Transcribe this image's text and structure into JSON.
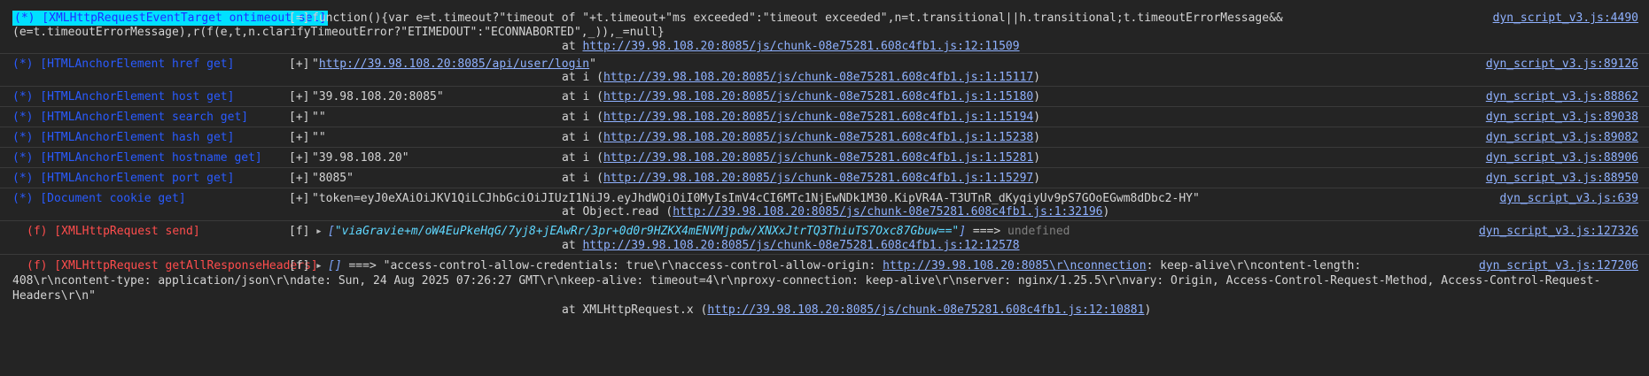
{
  "rows": [
    {
      "tag": "(*) [XMLHttpRequestEventTarget ontimeout set]",
      "prefix": "[=]",
      "code_line1": "function(){var e=t.timeout?\"timeout of \"+t.timeout+\"ms exceeded\":\"timeout exceeded\",n=t.transitional||h.transitional;t.timeoutErrorMessage&&",
      "code_line2": "(e=t.timeoutErrorMessage),r(f(e,t,n.clarifyTimeoutError?\"ETIMEDOUT\":\"ECONNABORTED\",_)),_=null}",
      "at_prefix": "at ",
      "at_link": "http://39.98.108.20:8085/js/chunk-08e75281.608c4fb1.js:12:11509",
      "at_suffix": "",
      "source": "dyn_script_v3.js:4490"
    },
    {
      "tag": "(*) [HTMLAnchorElement href get]",
      "prefix": "[+]",
      "value_open": "\"",
      "value_link": "http://39.98.108.20:8085/api/user/login",
      "value_close": "\"",
      "at_prefix": "at i (",
      "at_link": "http://39.98.108.20:8085/js/chunk-08e75281.608c4fb1.js:1:15117",
      "at_suffix": ")",
      "source": "dyn_script_v3.js:89126"
    },
    {
      "tag": "(*) [HTMLAnchorElement host get]",
      "prefix": "[+]",
      "value": "\"39.98.108.20:8085\"",
      "at_prefix": "at i (",
      "at_link": "http://39.98.108.20:8085/js/chunk-08e75281.608c4fb1.js:1:15180",
      "at_suffix": ")",
      "source": "dyn_script_v3.js:88862"
    },
    {
      "tag": "(*) [HTMLAnchorElement search get]",
      "prefix": "[+]",
      "value": "\"\"",
      "at_prefix": "at i (",
      "at_link": "http://39.98.108.20:8085/js/chunk-08e75281.608c4fb1.js:1:15194",
      "at_suffix": ")",
      "source": "dyn_script_v3.js:89038"
    },
    {
      "tag": "(*) [HTMLAnchorElement hash get]",
      "prefix": "[+]",
      "value": "\"\"",
      "at_prefix": "at i (",
      "at_link": "http://39.98.108.20:8085/js/chunk-08e75281.608c4fb1.js:1:15238",
      "at_suffix": ")",
      "source": "dyn_script_v3.js:89082"
    },
    {
      "tag": "(*) [HTMLAnchorElement hostname get]",
      "prefix": "[+]",
      "value": "\"39.98.108.20\"",
      "at_prefix": "at i (",
      "at_link": "http://39.98.108.20:8085/js/chunk-08e75281.608c4fb1.js:1:15281",
      "at_suffix": ")",
      "source": "dyn_script_v3.js:88906"
    },
    {
      "tag": "(*) [HTMLAnchorElement port get]",
      "prefix": "[+]",
      "value": "\"8085\"",
      "at_prefix": "at i (",
      "at_link": "http://39.98.108.20:8085/js/chunk-08e75281.608c4fb1.js:1:15297",
      "at_suffix": ")",
      "source": "dyn_script_v3.js:88950"
    },
    {
      "tag": "(*) [Document cookie get]",
      "prefix": "[+]",
      "value": "\"token=eyJ0eXAiOiJKV1QiLCJhbGciOiJIUzI1NiJ9.eyJhdWQiOiI0MyIsImV4cCI6MTc1NjEwNDk1M30.KipVR4A-T3UTnR_dKyqiyUv9pS7GOoEGwm8dDbc2-HY\"",
      "at_prefix": "at Object.read (",
      "at_link": "http://39.98.108.20:8085/js/chunk-08e75281.608c4fb1.js:1:32196",
      "at_suffix": ")",
      "source": "dyn_script_v3.js:639"
    },
    {
      "tag": "(f) [XMLHttpRequest send]",
      "prefix": "[f]",
      "triangle": "▸",
      "arg_open": "[",
      "arg_str": "\"viaGravie+m/oW4EuPkeHqG/7yj8+jEAwRr/3pr+0d0r9HZKX4mENVMjpdw/XNXxJtrTQ3ThiuTS7Oxc87Gbuw==\"",
      "arg_close": "]",
      "arrow": " ===> ",
      "result": "undefined",
      "at_prefix": "at ",
      "at_link": "http://39.98.108.20:8085/js/chunk-08e75281.608c4fb1.js:12:12578",
      "at_suffix": "",
      "source": "dyn_script_v3.js:127326"
    },
    {
      "tag": "(f) [XMLHttpRequest getAllResponseHeaders]",
      "prefix": "[f]",
      "triangle": "▸",
      "args": "[]",
      "arrow": " ===> ",
      "hdr_part1": "\"access-control-allow-credentials: true\\r\\naccess-control-allow-origin: ",
      "hdr_link": "http://39.98.108.20:8085\\r\\nconnection",
      "hdr_part2": ": keep-alive\\r\\ncontent-length:",
      "hdr_line2": "408\\r\\ncontent-type: application/json\\r\\ndate: Sun, 24 Aug 2025 07:26:27 GMT\\r\\nkeep-alive: timeout=4\\r\\nproxy-connection: keep-alive\\r\\nserver: nginx/1.25.5\\r\\nvary: Origin, Access-Control-Request-Method, Access-Control-Request-",
      "hdr_line3": "Headers\\r\\n\"",
      "at_prefix": "at XMLHttpRequest.x (",
      "at_link": "http://39.98.108.20:8085/js/chunk-08e75281.608c4fb1.js:12:10881",
      "at_suffix": ")",
      "source": "dyn_script_v3.js:127206"
    }
  ]
}
